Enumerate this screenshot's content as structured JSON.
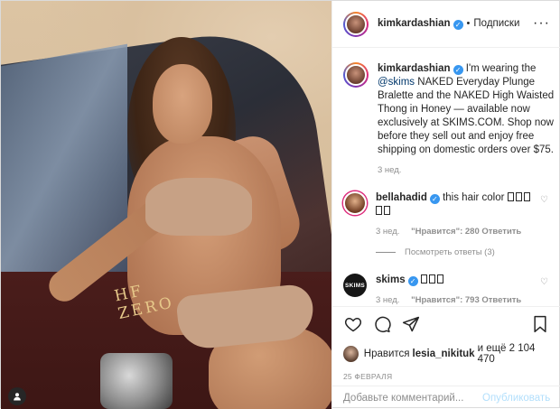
{
  "photo": {
    "car_badge": "HF ZERO",
    "car_side_text": "ZERO",
    "badge_icon": "user-tag-icon"
  },
  "header": {
    "username": "kimkardashian",
    "dot": "•",
    "follow_label": "Подписки",
    "more_icon": "ellipsis-icon"
  },
  "caption": {
    "username": "kimkardashian",
    "text_before": "I'm wearing the ",
    "mention": "@skims",
    "text_after": " NAKED Everyday Plunge Bralette and the NAKED High Waisted Thong in Honey — available now exclusively at SKIMS.COM. Shop now before they sell out and enjoy free shipping on domestic orders over $75.",
    "time": "3 нед."
  },
  "comments": [
    {
      "username": "bellahadid",
      "text": "this hair color",
      "emoji_count": 5,
      "time": "3 нед.",
      "likes": "\"Нравится\": 280",
      "reply": "Ответить",
      "view_replies": "Посмотреть ответы (3)"
    },
    {
      "username": "skims",
      "avatar_text": "SKIMS",
      "emoji_count": 3,
      "time": "3 нед.",
      "likes": "\"Нравится\": 793",
      "reply": "Ответить"
    }
  ],
  "actions": {
    "icons": [
      "heart-icon",
      "comment-icon",
      "share-icon",
      "bookmark-icon"
    ],
    "likes_prefix": "Нравится",
    "likes_user": "lesia_nikituk",
    "likes_suffix": "и ещё 2 104 470",
    "date": "25 ФЕВРАЛЯ"
  },
  "add_comment": {
    "placeholder": "Добавьте комментарий...",
    "publish_label": "Опубликовать"
  }
}
